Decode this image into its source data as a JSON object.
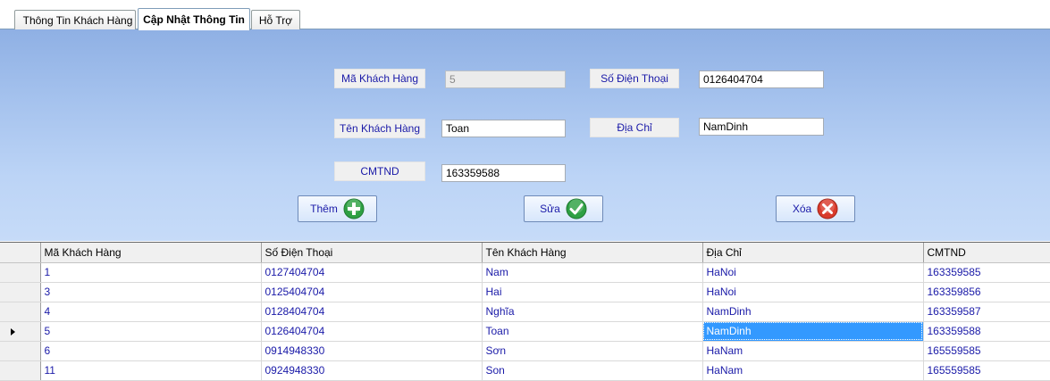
{
  "tabs": [
    {
      "label": "Thông Tin Khách Hàng"
    },
    {
      "label": "Cập Nhật Thông Tin"
    },
    {
      "label": "Hỗ Trợ"
    }
  ],
  "form": {
    "ma_khach_hang": {
      "label": "Mã Khách Hàng",
      "value": "5"
    },
    "ten_khach_hang": {
      "label": "Tên Khách Hàng",
      "value": "Toan"
    },
    "cmtnd": {
      "label": "CMTND",
      "value": "163359588"
    },
    "so_dien_thoai": {
      "label": "Số Điện Thoại",
      "value": "0126404704"
    },
    "dia_chi": {
      "label": "Địa Chỉ",
      "value": "NamDinh"
    }
  },
  "buttons": {
    "them": {
      "label": "Thêm",
      "icon": "plus-icon",
      "color": "#2ea043"
    },
    "sua": {
      "label": "Sửa",
      "icon": "check-icon",
      "color": "#2ea043"
    },
    "xoa": {
      "label": "Xóa",
      "icon": "cancel-icon",
      "color": "#d93a2b"
    }
  },
  "grid": {
    "columns": [
      "Mã Khách Hàng",
      "Số Điện Thoại",
      "Tên Khách Hàng",
      "Địa Chỉ",
      "CMTND"
    ],
    "rows": [
      [
        "1",
        "0127404704",
        "Nam",
        "HaNoi",
        "163359585"
      ],
      [
        "3",
        "0125404704",
        "Hai",
        "HaNoi",
        "163359856"
      ],
      [
        "4",
        "0128404704",
        "Nghĩa",
        "NamDinh",
        "163359587"
      ],
      [
        "5",
        "0126404704",
        "Toan",
        "NamDinh",
        "163359588"
      ],
      [
        "6",
        "0914948330",
        "Sơn",
        "HaNam",
        "165559585"
      ],
      [
        "11",
        "0924948330",
        "Son",
        "HaNam",
        "165559585"
      ]
    ],
    "current_row_index": 3,
    "selected_cell": {
      "row": 3,
      "col": 3
    },
    "text_color": "#1a1aa8",
    "selection_color": "#3399ff"
  }
}
